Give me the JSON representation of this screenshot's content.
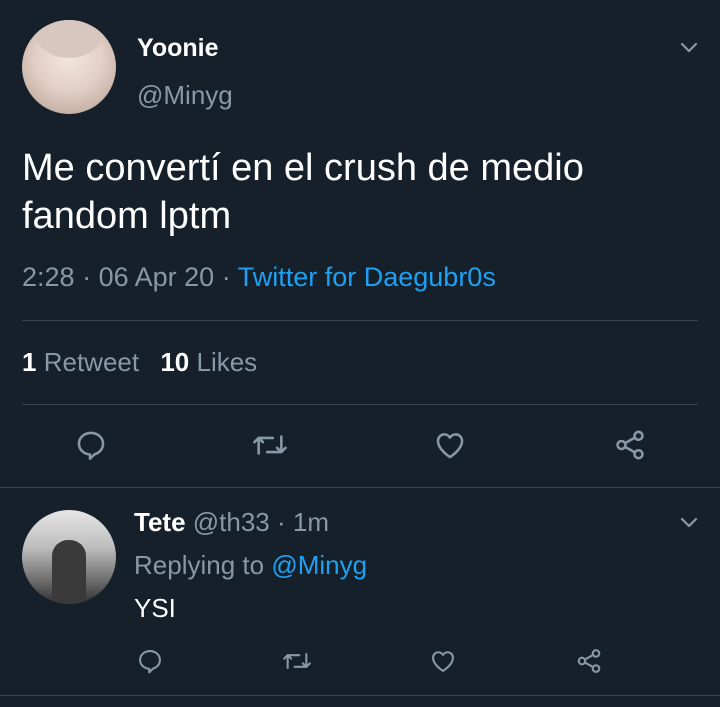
{
  "main_tweet": {
    "display_name": "Yoonie",
    "handle": "@Minyg",
    "text_line1": "Me convertí en el crush de medio",
    "text_line2": "fandom lptm",
    "time": "2:28",
    "sep1": "·",
    "date": "06 Apr 20",
    "sep2": "·",
    "source": "Twitter for Daegubr0s",
    "retweet_count": "1",
    "retweet_label": "Retweet",
    "likes_count": "10",
    "likes_label": "Likes"
  },
  "reply": {
    "display_name": "Tete",
    "handle": "@th33",
    "sep": "·",
    "age": "1m",
    "replying_prefix": "Replying to",
    "replying_handle": "@Minyg",
    "text": "YSI"
  },
  "icons": {
    "reply": "comment-icon",
    "retweet": "retweet-icon",
    "like": "heart-icon",
    "share": "share-icon",
    "menu": "chevron-down-icon"
  },
  "colors": {
    "background": "#15202b",
    "text": "#ffffff",
    "muted": "#8899a6",
    "accent": "#1da1f2",
    "divider": "#38444d"
  }
}
